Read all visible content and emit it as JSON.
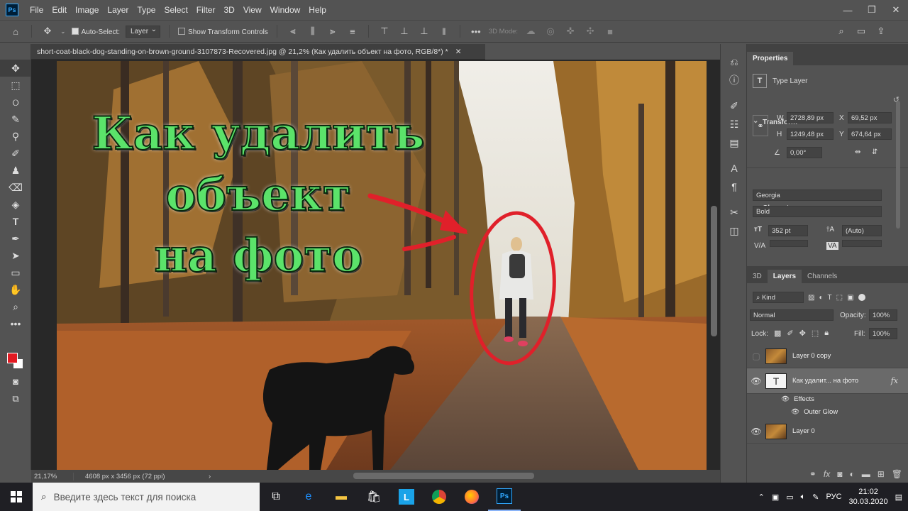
{
  "app": {
    "logo": "Ps"
  },
  "menu": [
    "File",
    "Edit",
    "Image",
    "Layer",
    "Type",
    "Select",
    "Filter",
    "3D",
    "View",
    "Window",
    "Help"
  ],
  "options": {
    "auto_select_label": "Auto-Select:",
    "auto_select_value": "Layer",
    "show_transform_label": "Show Transform Controls",
    "mode_3d_label": "3D Mode:"
  },
  "document": {
    "tab_title": "short-coat-black-dog-standing-on-brown-ground-3107873-Recovered.jpg @ 21,2% (Как удалить  объект  на фото, RGB/8*) *",
    "zoom": "21,17%",
    "size": "4608 px x 3456 px (72 ppi)"
  },
  "canvas_text": {
    "line1": "Как удалить",
    "line2": "объект",
    "line3": "на фото"
  },
  "properties": {
    "tab": "Properties",
    "layer_type": "Type Layer",
    "transform_title": "Transform",
    "w_label": "W",
    "w_value": "2728,89 px",
    "h_label": "H",
    "h_value": "1249,48 px",
    "x_label": "X",
    "x_value": "69,52 px",
    "y_label": "Y",
    "y_value": "674,64 px",
    "angle_value": "0,00°",
    "character_title": "Character",
    "font_family": "Georgia",
    "font_style": "Bold",
    "font_size": "352 pt",
    "leading": "(Auto)",
    "va_label": "V/A",
    "va_label2": "VA"
  },
  "layers_panel": {
    "tabs": [
      "3D",
      "Layers",
      "Channels"
    ],
    "kind": "Kind",
    "blend": "Normal",
    "opacity_label": "Opacity:",
    "opacity_value": "100%",
    "lock_label": "Lock:",
    "fill_label": "Fill:",
    "fill_value": "100%",
    "layers": [
      {
        "name": "Layer 0 copy"
      },
      {
        "name": "Как удалит... на фото",
        "fx": "fx"
      },
      {
        "name": "Effects"
      },
      {
        "name": "Outer Glow"
      },
      {
        "name": "Layer 0"
      }
    ]
  },
  "taskbar": {
    "search_placeholder": "Введите здесь текст для поиска",
    "lang": "РУС",
    "time": "21:02",
    "date": "30.03.2020"
  }
}
